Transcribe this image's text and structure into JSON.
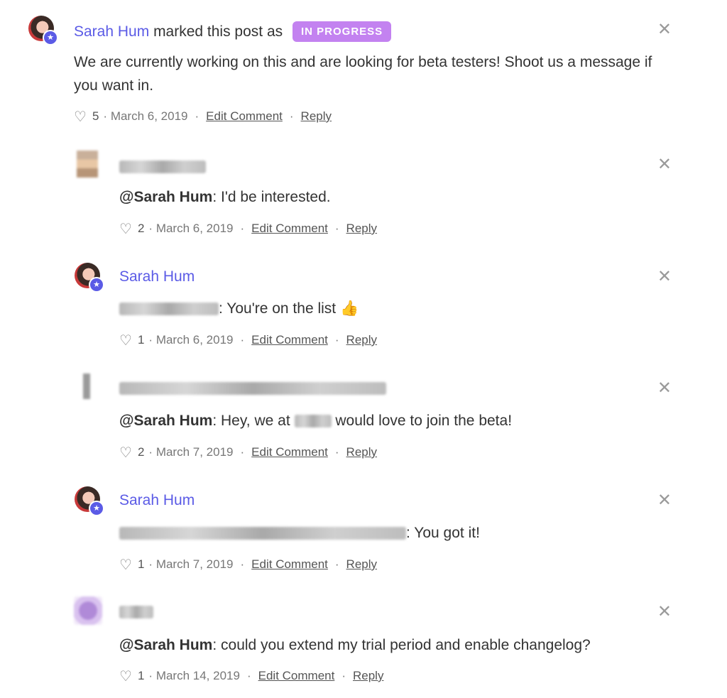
{
  "status_post": {
    "author": "Sarah Hum",
    "action_text": "marked this post as",
    "status_label": "IN PROGRESS",
    "body": "We are currently working on this and are looking for beta testers! Shoot us a message if you want in.",
    "likes": "5",
    "date": "March 6, 2019",
    "edit_label": "Edit Comment",
    "reply_label": "Reply"
  },
  "replies": [
    {
      "author_redacted": true,
      "mention": "@Sarah Hum",
      "text": ": I'd be interested.",
      "likes": "2",
      "date": "March 6, 2019",
      "edit_label": "Edit Comment",
      "reply_label": "Reply"
    },
    {
      "author": "Sarah Hum",
      "text": ": You're on the list",
      "emoji": "👍",
      "likes": "1",
      "date": "March 6, 2019",
      "edit_label": "Edit Comment",
      "reply_label": "Reply"
    },
    {
      "author_redacted": true,
      "mention": "@Sarah Hum",
      "text_before": ": Hey, we at",
      "text_after": "would love to join the beta!",
      "likes": "2",
      "date": "March 7, 2019",
      "edit_label": "Edit Comment",
      "reply_label": "Reply"
    },
    {
      "author": "Sarah Hum",
      "text": ": You got it!",
      "likes": "1",
      "date": "March 7, 2019",
      "edit_label": "Edit Comment",
      "reply_label": "Reply"
    },
    {
      "author_redacted": true,
      "mention": "@Sarah Hum",
      "text": ": could you extend my trial period and enable changelog?",
      "likes": "1",
      "date": "March 14, 2019",
      "edit_label": "Edit Comment",
      "reply_label": "Reply"
    }
  ],
  "icons": {
    "close": "close-icon",
    "like": "heart-icon",
    "admin_badge": "star-badge-icon"
  },
  "colors": {
    "accent": "#5b5be6",
    "status_pill": "#c382f0"
  }
}
